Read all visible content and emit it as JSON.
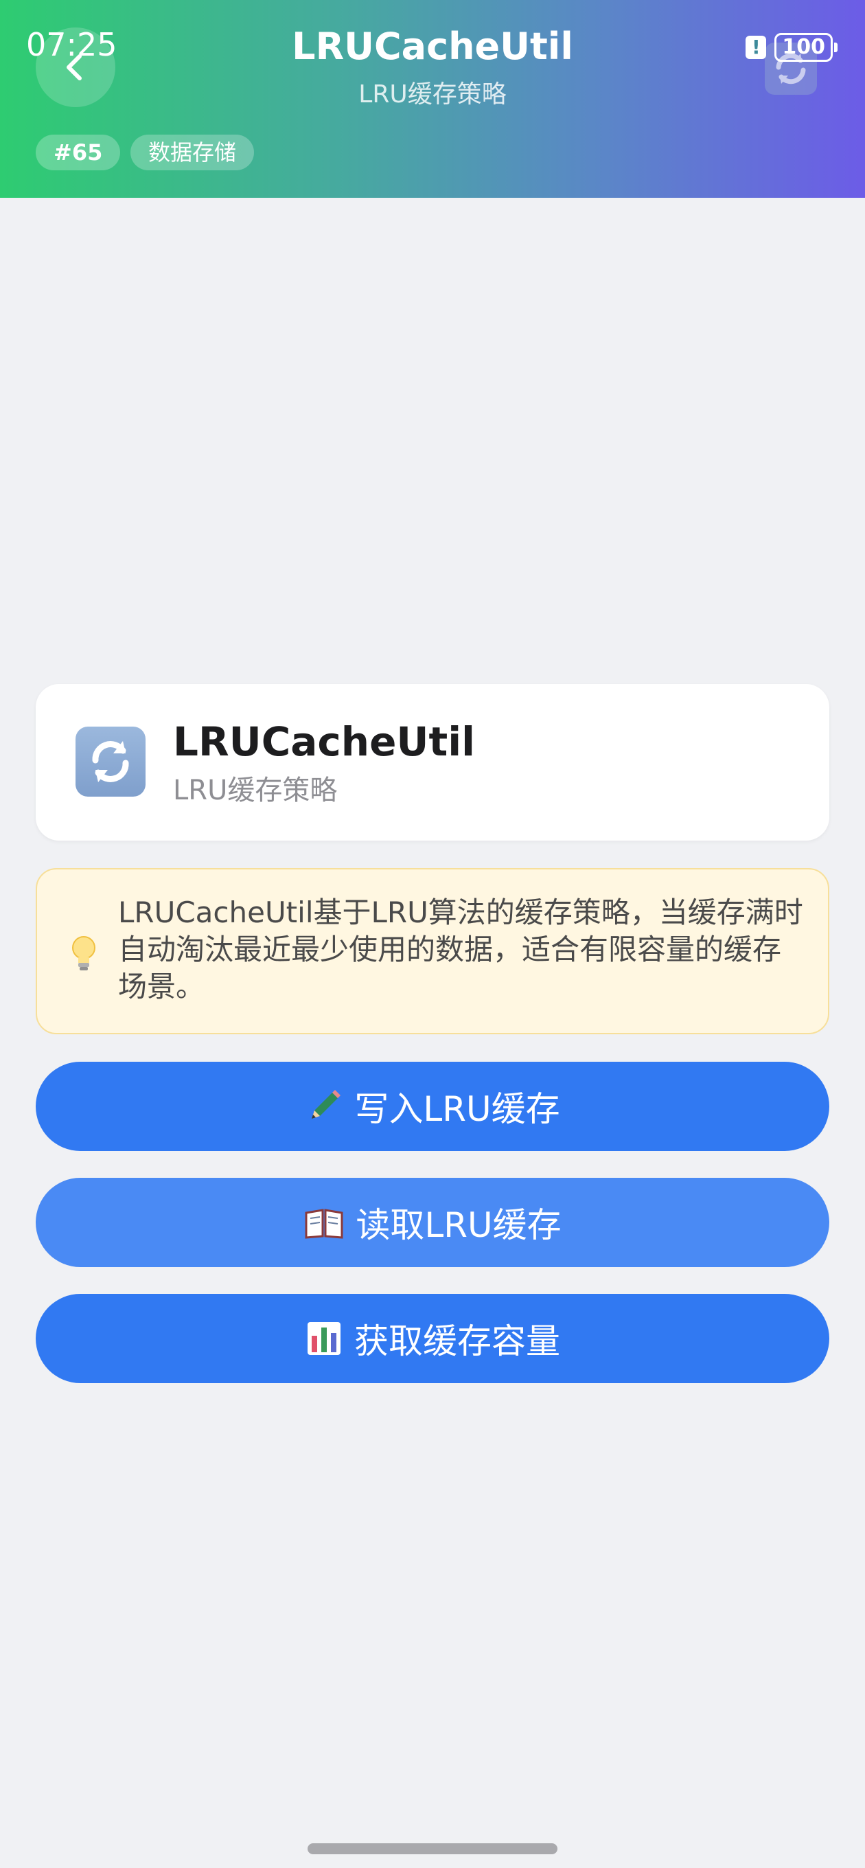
{
  "status_bar": {
    "time": "07:25",
    "battery": "100",
    "alert_icon": "alert-icon"
  },
  "header": {
    "title": "LRUCacheUtil",
    "subtitle": "LRU缓存策略",
    "back_icon": "chevron-left-icon",
    "action_icon": "refresh-icon",
    "tags": [
      "#65",
      "数据存储"
    ],
    "gradient": [
      "#2ecc71",
      "#6c5ce7"
    ]
  },
  "card": {
    "icon": "refresh-icon",
    "title": "LRUCacheUtil",
    "subtitle": "LRU缓存策略"
  },
  "tip": {
    "icon": "lightbulb-icon",
    "text": "LRUCacheUtil基于LRU算法的缓存策略，当缓存满时自动淘汰最近最少使用的数据，适合有限容量的缓存场景。"
  },
  "actions": [
    {
      "icon": "pencil-icon",
      "label": "写入LRU缓存"
    },
    {
      "icon": "book-icon",
      "label": "读取LRU缓存"
    },
    {
      "icon": "bar-chart-icon",
      "label": "获取缓存容量"
    }
  ],
  "colors": {
    "primary_button": "#3179f2",
    "tip_background": "#fff7e1",
    "page_background": "#f0f1f4"
  }
}
